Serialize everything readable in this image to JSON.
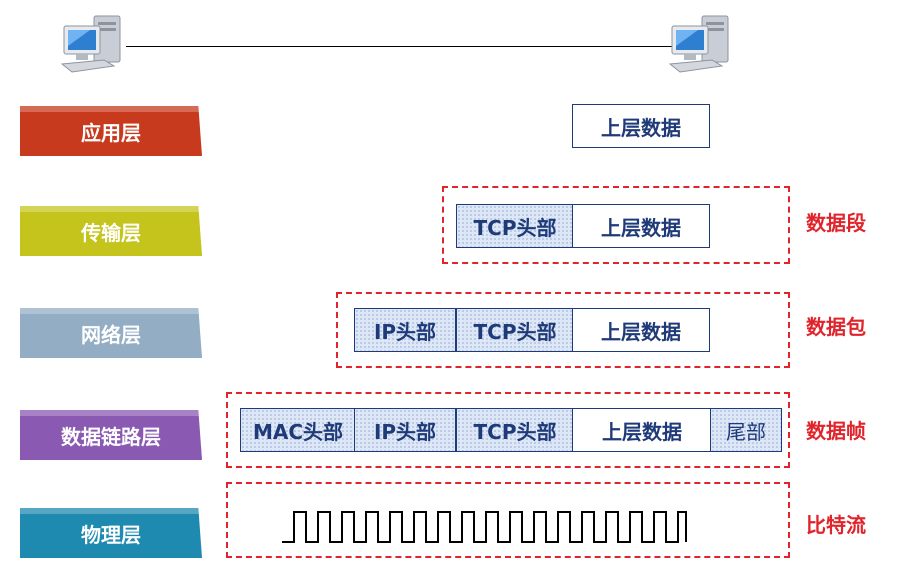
{
  "colors": {
    "application": "#c83a1d",
    "transport": "#c4c41c",
    "network": "#93aec4",
    "data_link": "#8a5ab2",
    "physical": "#1f8ab0",
    "dashed_border": "#e0242b",
    "header_fill": "#dde7f6",
    "cell_border": "#1f3a78"
  },
  "layers": [
    {
      "label": "应用层"
    },
    {
      "label": "传输层"
    },
    {
      "label": "网络层"
    },
    {
      "label": "数据链路层"
    },
    {
      "label": "物理层"
    }
  ],
  "pdu_labels": {
    "transport": "数据段",
    "network": "数据包",
    "data_link": "数据帧",
    "physical": "比特流"
  },
  "cells": {
    "upper_data": "上层数据",
    "tcp_header": "TCP头部",
    "ip_header": "IP头部",
    "mac_header": "MAC头部",
    "trailer": "尾部"
  },
  "icons": {
    "left_host": "computer-icon",
    "right_host": "computer-icon",
    "bitstream": "square-wave-icon"
  }
}
